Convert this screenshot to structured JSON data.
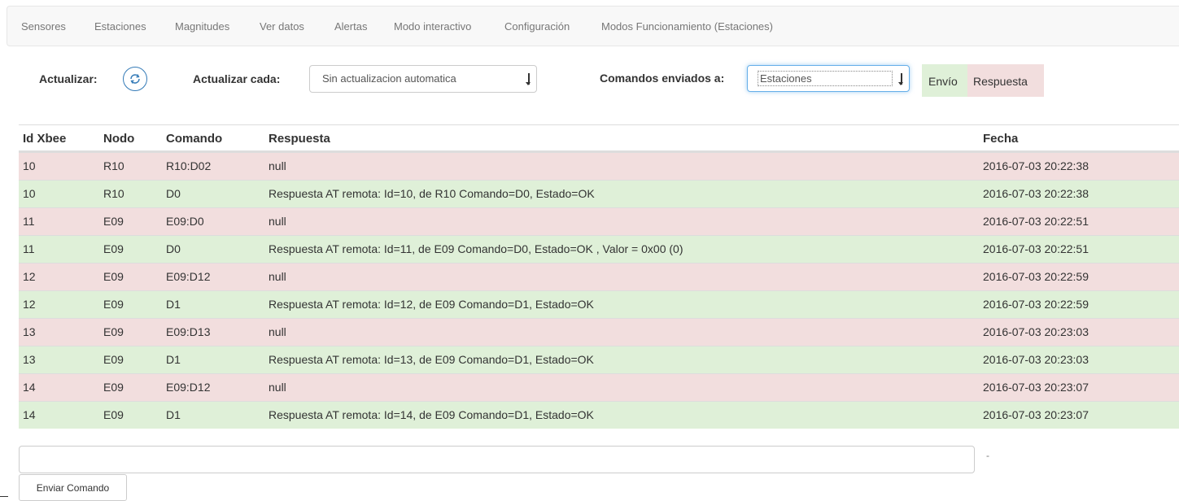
{
  "nav": {
    "items": [
      {
        "label": "Sensores"
      },
      {
        "label": "Estaciones"
      },
      {
        "label": "Magnitudes"
      },
      {
        "label": "Ver datos"
      },
      {
        "label": "Alertas"
      },
      {
        "label": "Modo interactivo"
      },
      {
        "label": "Configuración"
      },
      {
        "label": "Modos Funcionamiento (Estaciones)"
      }
    ]
  },
  "controls": {
    "refresh_label": "Actualizar:",
    "refresh_icon": "refresh-icon",
    "interval_label": "Actualizar cada:",
    "interval_value": "Sin actualizacion automatica",
    "target_label": "Comandos enviados a:",
    "target_value": "Estaciones",
    "legend_send": "Envío",
    "legend_response": "Respuesta"
  },
  "colors": {
    "send_row": "#dff0d8",
    "response_row": "#f2dede",
    "accent": "#337ab7"
  },
  "table": {
    "headers": {
      "id": "Id Xbee",
      "nodo": "Nodo",
      "comando": "Comando",
      "respuesta": "Respuesta",
      "fecha": "Fecha"
    },
    "rows": [
      {
        "type": "response",
        "id": "10",
        "nodo": "R10",
        "comando": "R10:D02",
        "respuesta": "null",
        "fecha": "2016-07-03 20:22:38"
      },
      {
        "type": "send",
        "id": "10",
        "nodo": "R10",
        "comando": "D0",
        "respuesta": "Respuesta AT remota: Id=10, de R10 Comando=D0, Estado=OK",
        "fecha": "2016-07-03 20:22:38"
      },
      {
        "type": "response",
        "id": "11",
        "nodo": "E09",
        "comando": "E09:D0",
        "respuesta": "null",
        "fecha": "2016-07-03 20:22:51"
      },
      {
        "type": "send",
        "id": "11",
        "nodo": "E09",
        "comando": "D0",
        "respuesta": "Respuesta AT remota: Id=11, de E09 Comando=D0, Estado=OK , Valor = 0x00 (0)",
        "fecha": "2016-07-03 20:22:51"
      },
      {
        "type": "response",
        "id": "12",
        "nodo": "E09",
        "comando": "E09:D12",
        "respuesta": "null",
        "fecha": "2016-07-03 20:22:59"
      },
      {
        "type": "send",
        "id": "12",
        "nodo": "E09",
        "comando": "D1",
        "respuesta": "Respuesta AT remota: Id=12, de E09 Comando=D1, Estado=OK",
        "fecha": "2016-07-03 20:22:59"
      },
      {
        "type": "response",
        "id": "13",
        "nodo": "E09",
        "comando": "E09:D13",
        "respuesta": "null",
        "fecha": "2016-07-03 20:23:03"
      },
      {
        "type": "send",
        "id": "13",
        "nodo": "E09",
        "comando": "D1",
        "respuesta": "Respuesta AT remota: Id=13, de E09 Comando=D1, Estado=OK",
        "fecha": "2016-07-03 20:23:03"
      },
      {
        "type": "response",
        "id": "14",
        "nodo": "E09",
        "comando": "E09:D12",
        "respuesta": "null",
        "fecha": "2016-07-03 20:23:07"
      },
      {
        "type": "send",
        "id": "14",
        "nodo": "E09",
        "comando": "D1",
        "respuesta": "Respuesta AT remota: Id=14, de E09 Comando=D1, Estado=OK",
        "fecha": "2016-07-03 20:23:07"
      }
    ]
  },
  "bottom": {
    "command_value": "",
    "status_text": "-",
    "send_button": "Enviar Comando"
  }
}
